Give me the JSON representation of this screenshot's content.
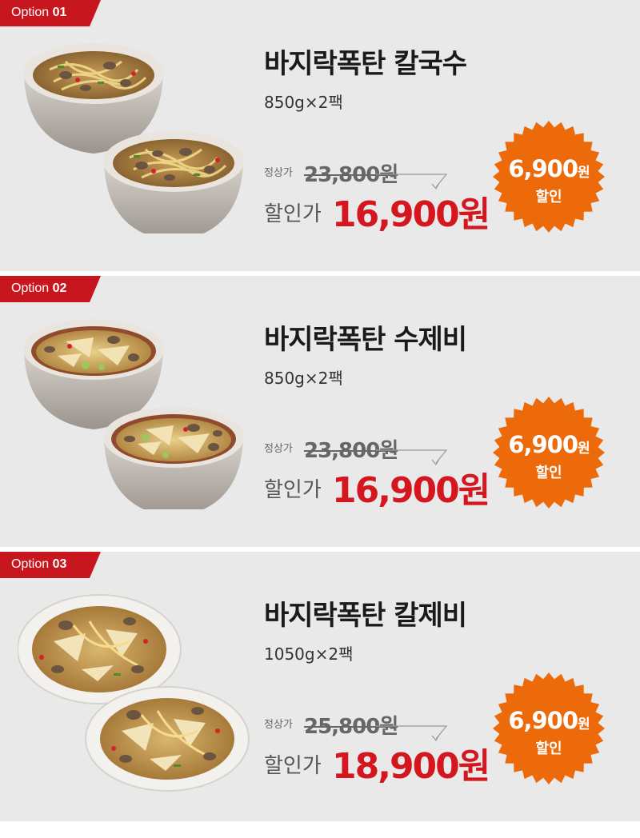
{
  "colors": {
    "panel_bg": "#eae9e9",
    "tag_red": "#c8161e",
    "sale_red": "#d4161e",
    "badge_orange": "#ec6a0a"
  },
  "options": [
    {
      "tag_prefix": "Option ",
      "tag_number": "01",
      "title": "바지락폭탄 칼국수",
      "weight": "850g×2팩",
      "original_label": "정상가",
      "original_price": "23,800원",
      "sale_label": "할인가",
      "sale_price": "16,900원",
      "badge_amount": "6,900",
      "badge_unit": "원",
      "badge_text": "할인",
      "image": "kalguksu-bowls"
    },
    {
      "tag_prefix": "Option ",
      "tag_number": "02",
      "title": "바지락폭탄 수제비",
      "weight": "850g×2팩",
      "original_label": "정상가",
      "original_price": "23,800원",
      "sale_label": "할인가",
      "sale_price": "16,900원",
      "badge_amount": "6,900",
      "badge_unit": "원",
      "badge_text": "할인",
      "image": "sujebi-bowls"
    },
    {
      "tag_prefix": "Option ",
      "tag_number": "03",
      "title": "바지락폭탄 칼제비",
      "weight": "1050g×2팩",
      "original_label": "정상가",
      "original_price": "25,800원",
      "sale_label": "할인가",
      "sale_price": "18,900원",
      "badge_amount": "6,900",
      "badge_unit": "원",
      "badge_text": "할인",
      "image": "kaljebi-bowls"
    }
  ]
}
